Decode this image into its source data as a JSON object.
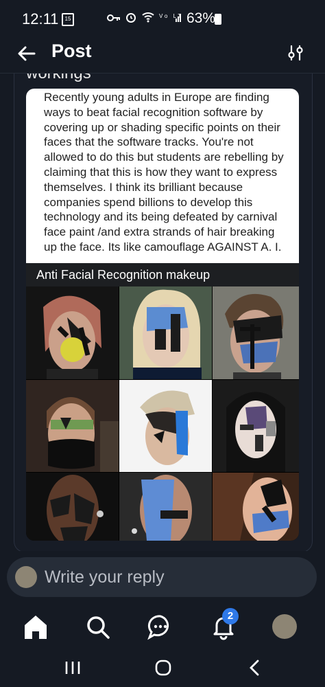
{
  "status_bar": {
    "time": "12:11",
    "calendar_day": "15",
    "battery": "63%"
  },
  "header": {
    "title": "Post"
  },
  "post": {
    "cut_heading": "workings",
    "embed_text": "Recently young adults in Europe are finding ways to beat facial recognition software by covering up or shading specific points on their faces that the software tracks. You're not allowed to do this but students are rebelling by claiming that this is how they want to express themselves. I think its brilliant because companies spend billions to develop this technology and its being defeated by carnival face paint /and extra strands of hair breaking up the face. Its like camouflage AGAINST A. I.",
    "embed_caption": "Anti Facial Recognition makeup"
  },
  "composer": {
    "placeholder": "Write your reply"
  },
  "bottom_nav": {
    "notifications_badge": "2"
  },
  "icons": [
    "back-arrow-icon",
    "filter-icon",
    "home-icon",
    "search-icon",
    "messages-icon",
    "bell-icon",
    "recents-icon",
    "home-circle-icon",
    "back-chevron-icon"
  ]
}
